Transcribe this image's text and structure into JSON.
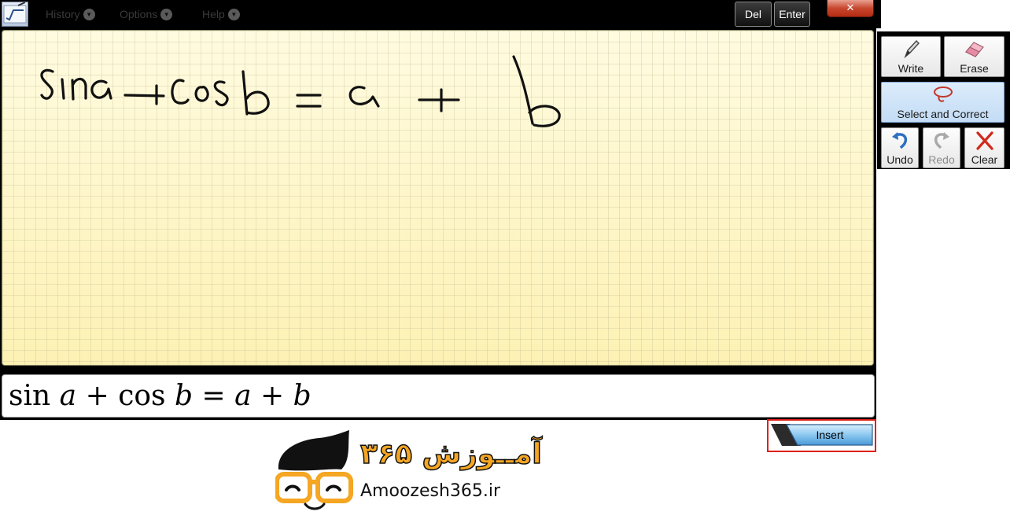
{
  "menubar": {
    "items": [
      "History",
      "Options",
      "Help"
    ],
    "del_label": "Del",
    "enter_label": "Enter",
    "close_glyph": "✕"
  },
  "tools": {
    "write": "Write",
    "erase": "Erase",
    "select_correct": "Select and Correct",
    "undo": "Undo",
    "redo": "Redo",
    "clear": "Clear"
  },
  "preview": {
    "parts": [
      "sin",
      "a",
      "+",
      "cos",
      "b",
      "=",
      "a",
      "+",
      "b"
    ]
  },
  "insert_label": "Insert",
  "watermark": {
    "logo_text": "آمــوزش ۳۶۵",
    "site": "Amoozesh365.ir"
  },
  "colors": {
    "pad_background": "#fff9cd",
    "ink": "#111111",
    "highlight": "#e0201a",
    "accent_blue": "#4a9ad8"
  },
  "icons": [
    "pen-icon",
    "eraser-icon",
    "lasso-icon",
    "undo-icon",
    "redo-icon",
    "clear-icon"
  ]
}
